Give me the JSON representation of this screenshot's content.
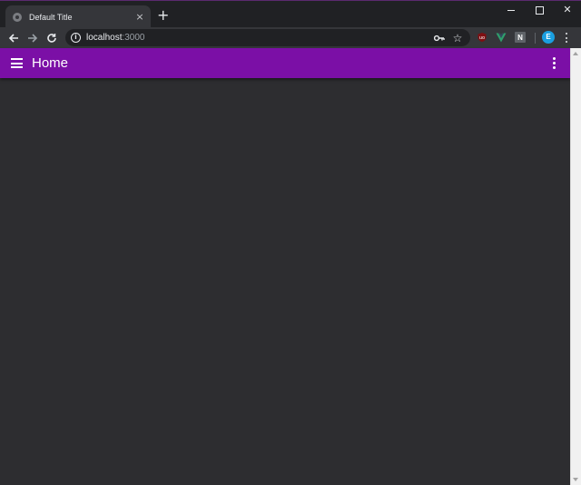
{
  "browser": {
    "tab": {
      "title": "Default Title",
      "close_glyph": "×"
    },
    "new_tab_glyph": "+",
    "window_controls": {
      "close_glyph": "✕"
    },
    "address": {
      "host": "localhost",
      "port": ":3000"
    },
    "extensions": {
      "n_label": "N"
    },
    "profile_initial": "E",
    "icons": [
      "back-arrow-icon",
      "forward-arrow-icon",
      "reload-icon",
      "info-icon",
      "key-icon",
      "star-icon",
      "ublock-icon",
      "vue-devtools-icon",
      "n-extension-icon",
      "kebab-menu-icon"
    ]
  },
  "app": {
    "title": "Home",
    "colors": {
      "appbar": "#7b0fa6",
      "background": "#2d2d30"
    }
  }
}
